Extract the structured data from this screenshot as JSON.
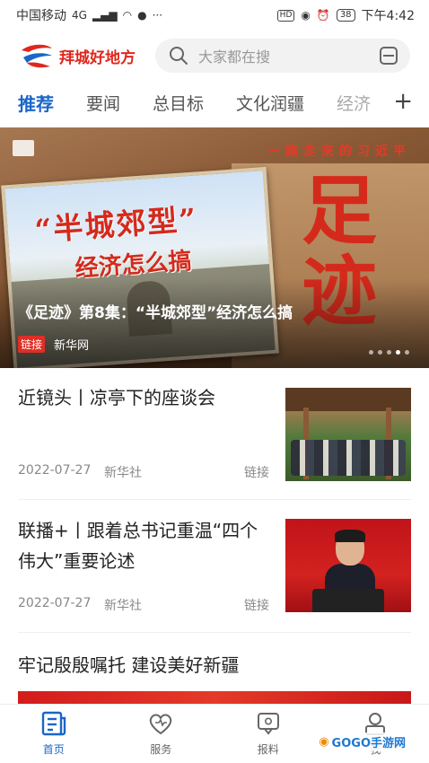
{
  "status_bar": {
    "carrier": "中国移动",
    "network": "4G",
    "hd_label": "HD",
    "battery": "38",
    "time": "下午4:42"
  },
  "header": {
    "logo_text": "拜城好地方",
    "search_placeholder": "大家都在搜"
  },
  "tabs": [
    {
      "label": "推荐",
      "active": true
    },
    {
      "label": "要闻",
      "active": false
    },
    {
      "label": "总目标",
      "active": false
    },
    {
      "label": "文化润疆",
      "active": false
    },
    {
      "label": "经济",
      "active": false
    }
  ],
  "tab_add": "+",
  "banner": {
    "poster_title_line1": "“半城郊型”",
    "poster_title_line2": "经济怎么搞",
    "series_tag": "一路走来的习近平",
    "big_char": "足迹",
    "caption": "《足迹》第8集：“半城郊型”经济怎么搞",
    "badge": "链接",
    "source": "新华网",
    "slide_count": 5,
    "active_slide": 3
  },
  "news": [
    {
      "title": "近镜头丨凉亭下的座谈会",
      "date": "2022-07-27",
      "source": "新华社",
      "type": "链接"
    },
    {
      "title": "联播+丨跟着总书记重温“四个伟大”重要论述",
      "date": "2022-07-27",
      "source": "新华社",
      "type": "链接"
    },
    {
      "title": "牢记殷殷嘱托 建设美好新疆"
    }
  ],
  "bottom_nav": [
    {
      "label": "首页",
      "icon": "home-news-icon",
      "active": true
    },
    {
      "label": "服务",
      "icon": "heart-service-icon",
      "active": false
    },
    {
      "label": "报料",
      "icon": "report-chat-icon",
      "active": false
    },
    {
      "label": "我",
      "icon": "user-icon",
      "active": false
    }
  ],
  "watermark": "GOGO手游网",
  "colors": {
    "accent_blue": "#1a66c8",
    "brand_red": "#e0261d",
    "badge_red": "#e02e24"
  }
}
